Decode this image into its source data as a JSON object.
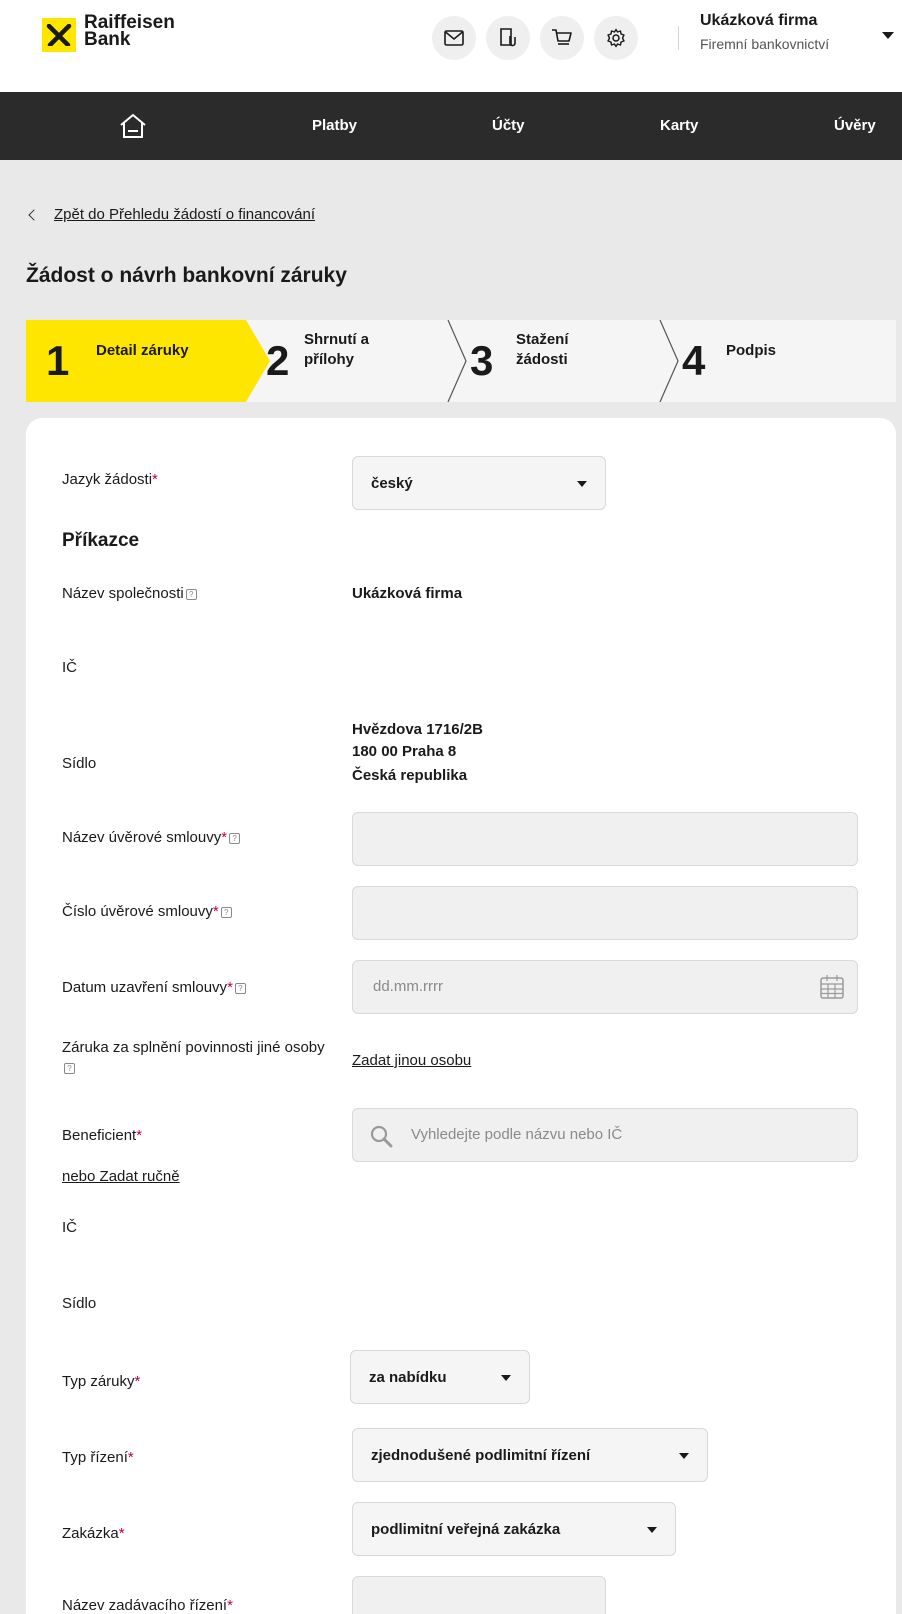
{
  "brand": {
    "line1": "Raiffeisen",
    "line2": "Bank"
  },
  "company": {
    "name": "Ukázková firma",
    "subtitle": "Firemní bankovnictví"
  },
  "nav": {
    "payments": "Platby",
    "accounts": "Účty",
    "cards": "Karty",
    "loans": "Úvěry"
  },
  "back_link": "Zpět do Přehledu žádostí o financování",
  "page_title": "Žádost o návrh bankovní záruky",
  "steps": [
    {
      "num": "1",
      "label": "Detail záruky"
    },
    {
      "num": "2",
      "label": "Shrnutí a přílohy"
    },
    {
      "num": "3",
      "label": "Stažení žádosti"
    },
    {
      "num": "4",
      "label": "Podpis"
    }
  ],
  "form": {
    "language": {
      "label": "Jazyk žádosti",
      "value": "český"
    },
    "section_title": "Příkazce",
    "company_name": {
      "label": "Název společnosti",
      "value": "Ukázková firma"
    },
    "ico": {
      "label": "IČ"
    },
    "seat": {
      "label": "Sídlo",
      "line1": "Hvězdova 1716/2B",
      "line2": "180 00 Praha 8",
      "line3": "Česká republika"
    },
    "contract_name": {
      "label": "Název úvěrové smlouvy"
    },
    "contract_number": {
      "label": "Číslo úvěrové smlouvy"
    },
    "contract_date": {
      "label": "Datum uzavření smlouvy",
      "placeholder": "dd.mm.rrrr"
    },
    "guarantee_other": {
      "label": "Záruka za splnění povinnosti jiné osoby",
      "link": "Zadat jinou osobu"
    },
    "beneficiary": {
      "label": "Beneficient",
      "placeholder": "Vyhledejte podle názvu nebo IČ",
      "manual_link": "nebo Zadat ručně"
    },
    "ben_ico": {
      "label": "IČ"
    },
    "ben_seat": {
      "label": "Sídlo"
    },
    "guarantee_type": {
      "label": "Typ záruky",
      "value": "za nabídku"
    },
    "procedure_type": {
      "label": "Typ řízení",
      "value": "zjednodušené podlimitní řízení"
    },
    "contract_kind": {
      "label": "Zakázka",
      "value": "podlimitní veřejná zakázka"
    },
    "tender_name": {
      "label": "Název zadávacího řízení"
    }
  },
  "required_mark": "*",
  "info_mark": "?",
  "colors": {
    "brand_yellow": "#fee600",
    "nav_bg": "#2b2b2b",
    "required": "#c3002f"
  }
}
